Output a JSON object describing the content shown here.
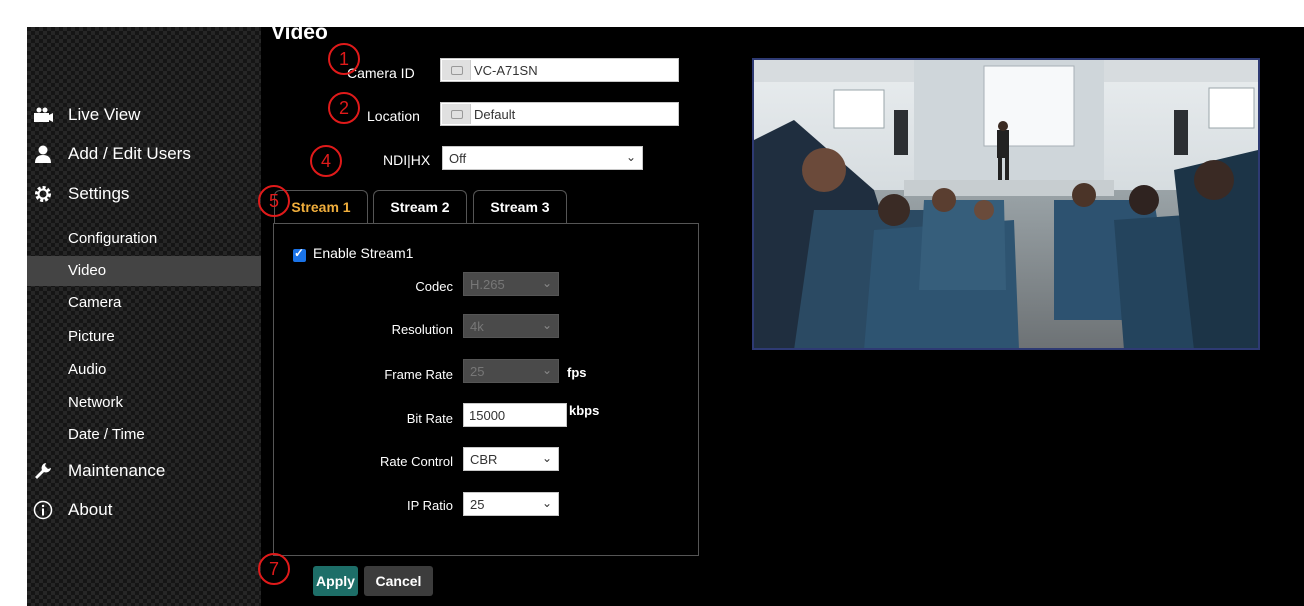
{
  "page": {
    "title": "Video"
  },
  "sidebar": {
    "nav": [
      {
        "label": "Live View",
        "icon": "camera-users-icon"
      },
      {
        "label": "Add / Edit Users",
        "icon": "user-icon"
      },
      {
        "label": "Settings",
        "icon": "gear-icon"
      }
    ],
    "settings_items": [
      {
        "label": "Configuration",
        "active": false
      },
      {
        "label": "Video",
        "active": true
      },
      {
        "label": "Camera",
        "active": false
      },
      {
        "label": "Picture",
        "active": false
      },
      {
        "label": "Audio",
        "active": false
      },
      {
        "label": "Network",
        "active": false
      },
      {
        "label": "Date / Time",
        "active": false
      }
    ],
    "bottom_nav": [
      {
        "label": "Maintenance",
        "icon": "wrench-icon"
      },
      {
        "label": "About",
        "icon": "info-icon"
      }
    ]
  },
  "fields": {
    "camera_id": {
      "label": "Camera ID",
      "value": "VC-A71SN"
    },
    "location": {
      "label": "Location",
      "value": "Default"
    },
    "ndi": {
      "label": "NDI|HX",
      "value": "Off"
    }
  },
  "tabs": [
    {
      "label": "Stream 1",
      "active": true
    },
    {
      "label": "Stream 2",
      "active": false
    },
    {
      "label": "Stream 3",
      "active": false
    }
  ],
  "stream": {
    "enable_label": "Enable Stream1",
    "enabled": true,
    "codec": {
      "label": "Codec",
      "value": "H.265"
    },
    "resolution": {
      "label": "Resolution",
      "value": "4k"
    },
    "frame_rate": {
      "label": "Frame Rate",
      "value": "25",
      "unit": "fps"
    },
    "bit_rate": {
      "label": "Bit Rate",
      "value": "15000",
      "unit": "kbps"
    },
    "rate_control": {
      "label": "Rate Control",
      "value": "CBR"
    },
    "ip_ratio": {
      "label": "IP Ratio",
      "value": "25"
    }
  },
  "buttons": {
    "apply": "Apply",
    "cancel": "Cancel"
  },
  "callouts": [
    "1",
    "2",
    "4",
    "5",
    "7"
  ],
  "colors": {
    "active_tab": "#f0ae3c",
    "apply": "#1d6e68",
    "callout": "#e01a1a",
    "preview_border": "#2e3a73"
  }
}
